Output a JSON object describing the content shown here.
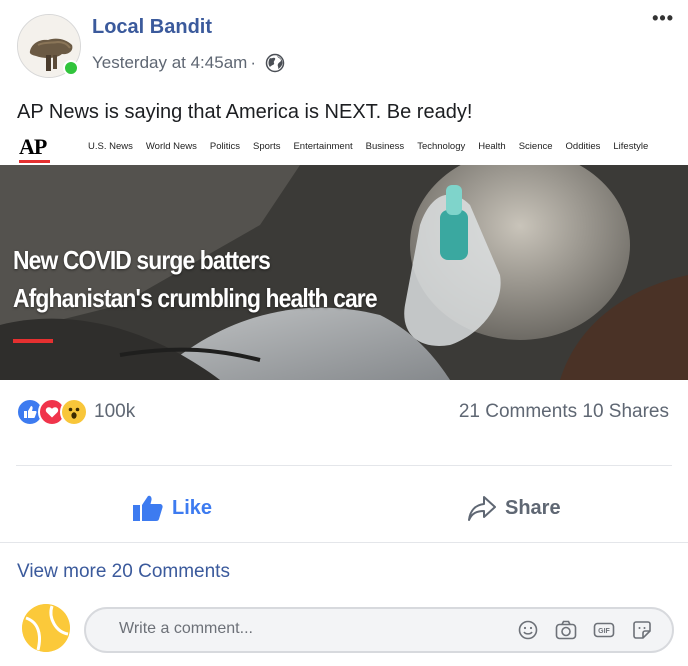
{
  "post": {
    "author": "Local Bandit",
    "timestamp": "Yesterday at 4:45am",
    "separator": "·",
    "privacy_icon": "globe-icon",
    "more_label": "•••",
    "text": "AP News is saying that America is NEXT. Be ready!"
  },
  "article": {
    "logo": "AP",
    "nav": [
      "U.S. News",
      "World News",
      "Politics",
      "Sports",
      "Entertainment",
      "Business",
      "Technology",
      "Health",
      "Science",
      "Oddities",
      "Lifestyle"
    ],
    "headline_line1": "New COVID surge batters",
    "headline_line2": "Afghanistan's crumbling health care"
  },
  "engagement": {
    "reaction_icons": [
      "like-reaction-icon",
      "love-reaction-icon",
      "wow-reaction-icon"
    ],
    "reaction_count": "100k",
    "comments_shares": "21 Comments 10 Shares"
  },
  "actions": {
    "like_label": "Like",
    "share_label": "Share"
  },
  "comments": {
    "view_more": "View more 20 Comments",
    "placeholder": "Write a comment...",
    "input_icons": [
      "emoji-icon",
      "camera-icon",
      "gif-icon",
      "sticker-icon"
    ]
  },
  "colors": {
    "brand_blue": "#3b5a9c",
    "like_blue": "#3d7bf0",
    "online_green": "#31c43c",
    "ap_red": "#e53030"
  }
}
